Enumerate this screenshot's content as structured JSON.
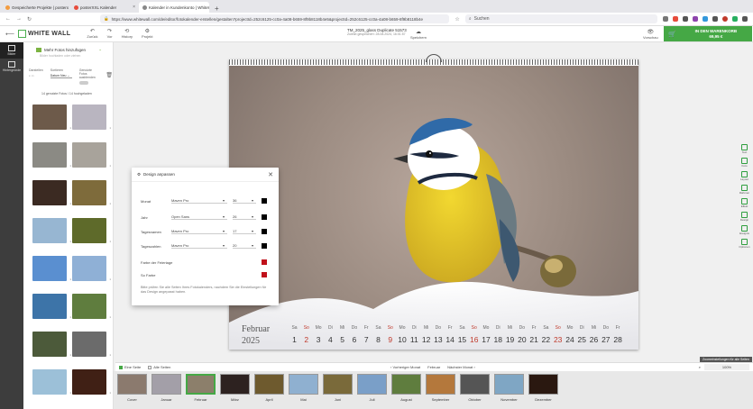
{
  "browser": {
    "tabs": [
      {
        "label": "Gespeicherte Projekte | posterx",
        "active": false,
        "color": "#f39c40"
      },
      {
        "label": "posterXXL Kalender",
        "active": false,
        "color": "#e74c3c"
      },
      {
        "label": "Kalender in Kundenkonto | WhiteWall",
        "active": true,
        "color": "#888888"
      }
    ],
    "url": "https://www.whitewall.com/de/editor/fotokalender-erstellen/gestalten?projectId=252c6125-cc0a-4a08-b659-8f9b8118b4e5&projectId=252c6125-cc0a-4a08-b659-8f9b8118b4e",
    "search_placeholder": "Suchen"
  },
  "header": {
    "logo": "WHITE WALL",
    "buttons": [
      {
        "label": "Zurück",
        "icon": "undo-icon"
      },
      {
        "label": "Vor",
        "icon": "redo-icon"
      },
      {
        "label": "History",
        "icon": "history-icon"
      },
      {
        "label": "Projekt",
        "icon": "gear-icon"
      }
    ],
    "project_title": "TM_2025_glass Duplicate 51573",
    "project_sub": "Zuletzt gespeichert: 28.08.2024, 16:01:57",
    "save_label": "Speichern",
    "preview_label": "Vorschau",
    "cart_label": "IN DEN WARENKORB",
    "cart_price": "69,95 €"
  },
  "rail": [
    {
      "label": "Bilder",
      "active": true
    },
    {
      "label": "Hintergründe",
      "active": false
    }
  ],
  "panel": {
    "add_photos": "Mehr Fotos hinzufügen",
    "subtle": "Bilder hochladen oder ziehen",
    "sort_labels": [
      "Darstellen",
      "Sortieren",
      "Genutzte Fotos ausblenden"
    ],
    "sort_value": "Datum Neu",
    "used_count": "14 genutzte Fotos / 14 hochgeladen",
    "photos": [
      {
        "color": "#6d5a4a",
        "count": "1"
      },
      {
        "color": "#b9b5c0",
        "count": "1"
      },
      {
        "color": "#8b8a84",
        "count": "1"
      },
      {
        "color": "#a8a39b",
        "count": "1"
      },
      {
        "color": "#3b2a22",
        "count": "1"
      },
      {
        "color": "#7e6b3b",
        "count": "1"
      },
      {
        "color": "#97b6d2",
        "count": "1"
      },
      {
        "color": "#5e6a2a",
        "count": "1"
      },
      {
        "color": "#5a8fd0",
        "count": "1"
      },
      {
        "color": "#8fb0d6",
        "count": "1"
      },
      {
        "color": "#3d74a8",
        "count": "1"
      },
      {
        "color": "#5f7d3e",
        "count": "1"
      },
      {
        "color": "#4c5a3a",
        "count": "1"
      },
      {
        "color": "#6b6b6b",
        "count": "1"
      },
      {
        "color": "#9cc0d8",
        "count": "1"
      },
      {
        "color": "#402015",
        "count": "1"
      }
    ]
  },
  "calendar": {
    "month": "Februar",
    "year": "2025",
    "days": [
      {
        "n": "Sa",
        "d": "1",
        "red": false
      },
      {
        "n": "So",
        "d": "2",
        "red": true
      },
      {
        "n": "Mo",
        "d": "3",
        "red": false
      },
      {
        "n": "Di",
        "d": "4",
        "red": false
      },
      {
        "n": "Mi",
        "d": "5",
        "red": false
      },
      {
        "n": "Do",
        "d": "6",
        "red": false
      },
      {
        "n": "Fr",
        "d": "7",
        "red": false
      },
      {
        "n": "Sa",
        "d": "8",
        "red": false
      },
      {
        "n": "So",
        "d": "9",
        "red": true
      },
      {
        "n": "Mo",
        "d": "10",
        "red": false
      },
      {
        "n": "Di",
        "d": "11",
        "red": false
      },
      {
        "n": "Mi",
        "d": "12",
        "red": false
      },
      {
        "n": "Do",
        "d": "13",
        "red": false
      },
      {
        "n": "Fr",
        "d": "14",
        "red": false
      },
      {
        "n": "Sa",
        "d": "15",
        "red": false
      },
      {
        "n": "So",
        "d": "16",
        "red": true
      },
      {
        "n": "Mo",
        "d": "17",
        "red": false
      },
      {
        "n": "Di",
        "d": "18",
        "red": false
      },
      {
        "n": "Mi",
        "d": "19",
        "red": false
      },
      {
        "n": "Do",
        "d": "20",
        "red": false
      },
      {
        "n": "Fr",
        "d": "21",
        "red": false
      },
      {
        "n": "Sa",
        "d": "22",
        "red": false
      },
      {
        "n": "So",
        "d": "23",
        "red": true
      },
      {
        "n": "Mo",
        "d": "24",
        "red": false
      },
      {
        "n": "Di",
        "d": "25",
        "red": false
      },
      {
        "n": "Mi",
        "d": "26",
        "red": false
      },
      {
        "n": "Do",
        "d": "27",
        "red": false
      },
      {
        "n": "Fr",
        "d": "28",
        "red": false
      }
    ]
  },
  "dialog": {
    "title": "Design anpassen",
    "rows": [
      {
        "label": "Monat",
        "font": "Maven Pro",
        "size": "36",
        "color": "#000000"
      },
      {
        "label": "Jahr",
        "font": "Open Sans",
        "size": "26",
        "color": "#000000"
      },
      {
        "label": "Tagesnamen",
        "font": "Maven Pro",
        "size": "17",
        "color": "#000000"
      },
      {
        "label": "Tageszahlen",
        "font": "Maven Pro",
        "size": "20",
        "color": "#000000"
      }
    ],
    "holiday_label": "Farbe der Feiertage",
    "sunday_label": "So Farbe",
    "accent": "#c0101a",
    "note": "Bitte prüfen Sie alle Seiten Ihres Fotokalenders, nachdem Sie die Einstellungen für das Design angepasst haben."
  },
  "tools": [
    "Text",
    "Foto",
    "Layout",
    "Rahmen",
    "Effekt",
    "Design",
    "Ereignis",
    "Optionen"
  ],
  "stripbar": {
    "one_page": "Eine Seite",
    "all_pages": "Alle Seiten",
    "prev": "Vorheriger Monat",
    "current": "Februar",
    "next": "Nächster Monat",
    "zoom": "100%",
    "zoom_tip": "Zoomeinstellungen für alle Seiten"
  },
  "months": [
    {
      "label": "Cover",
      "color": "#8b7a6e",
      "active": false
    },
    {
      "label": "Januar",
      "color": "#a39fa8",
      "active": false
    },
    {
      "label": "Februar",
      "color": "#8c7f6b",
      "active": true
    },
    {
      "label": "März",
      "color": "#2d2220",
      "active": false
    },
    {
      "label": "April",
      "color": "#6e5a2e",
      "active": false
    },
    {
      "label": "Mai",
      "color": "#8fb0d0",
      "active": false
    },
    {
      "label": "Juni",
      "color": "#7a6a3a",
      "active": false
    },
    {
      "label": "Juli",
      "color": "#7a9fc8",
      "active": false
    },
    {
      "label": "August",
      "color": "#5f7d3e",
      "active": false
    },
    {
      "label": "September",
      "color": "#b4783c",
      "active": false
    },
    {
      "label": "Oktober",
      "color": "#555555",
      "active": false
    },
    {
      "label": "November",
      "color": "#7fa6c4",
      "active": false
    },
    {
      "label": "Dezember",
      "color": "#2a1810",
      "active": false
    }
  ]
}
